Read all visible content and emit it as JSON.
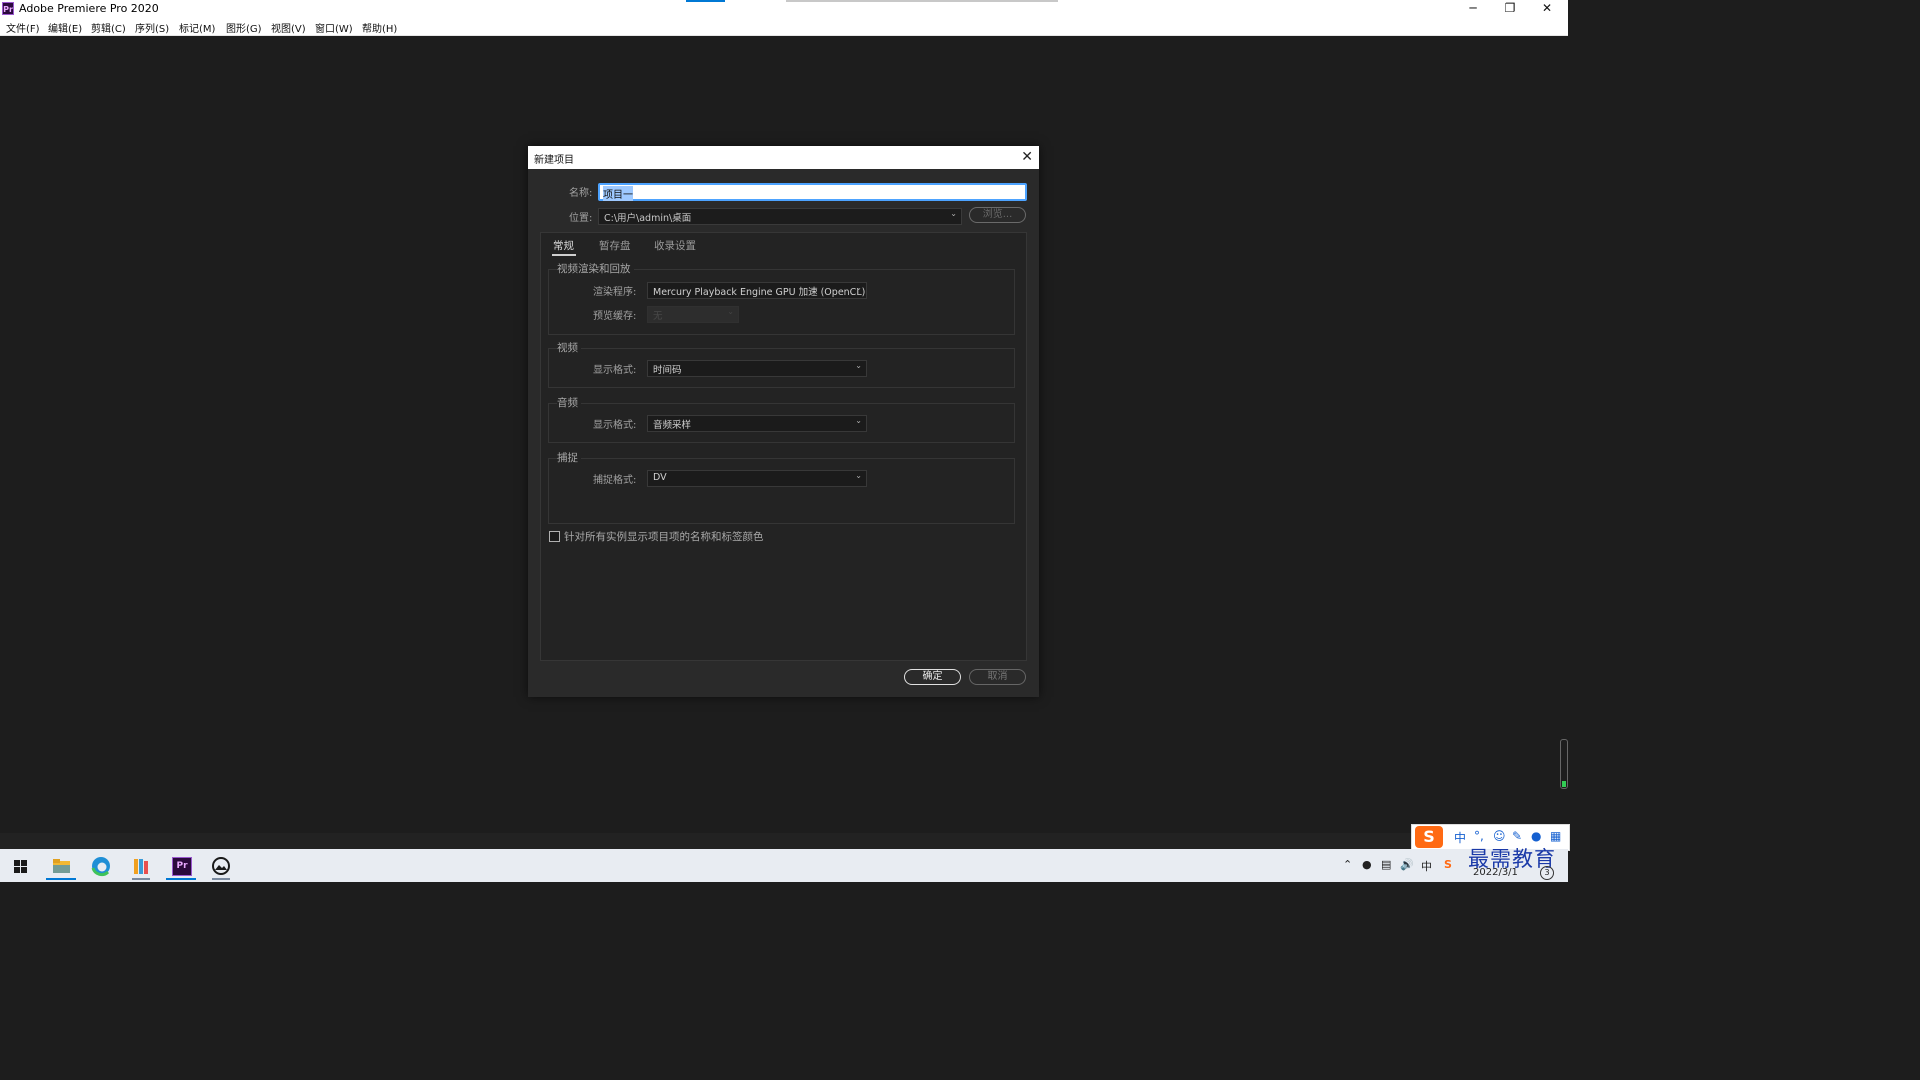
{
  "window": {
    "title": "Adobe Premiere Pro 2020",
    "app_icon": "Pr"
  },
  "window_controls": {
    "minimize": "─",
    "restore": "❐",
    "close": "✕"
  },
  "menubar": [
    "文件(F)",
    "编辑(E)",
    "剪辑(C)",
    "序列(S)",
    "标记(M)",
    "图形(G)",
    "视图(V)",
    "窗口(W)",
    "帮助(H)"
  ],
  "dialog": {
    "title": "新建项目",
    "close_icon": "✕",
    "name_label": "名称:",
    "name_value": "项目一",
    "location_label": "位置:",
    "location_value": "C:\\用户\\admin\\桌面",
    "browse_label": "浏览...",
    "tabs": [
      "常规",
      "暂存盘",
      "收录设置"
    ],
    "active_tab": "常规",
    "groups": {
      "render": {
        "title": "视频渲染和回放",
        "renderer_label": "渲染程序:",
        "renderer_value": "Mercury Playback Engine GPU 加速 (OpenCL)",
        "preview_cache_label": "预览缓存:",
        "preview_cache_value": "无"
      },
      "video": {
        "title": "视频",
        "format_label": "显示格式:",
        "format_value": "时间码"
      },
      "audio": {
        "title": "音频",
        "format_label": "显示格式:",
        "format_value": "音频采样"
      },
      "capture": {
        "title": "捕捉",
        "format_label": "捕捉格式:",
        "format_value": "DV"
      }
    },
    "checkbox_label": "针对所有实例显示项目项的名称和标签颜色",
    "checkbox_checked": false,
    "ok_label": "确定",
    "cancel_label": "取消"
  },
  "taskbar": {
    "apps": [
      "windows-start-icon",
      "file-explorer-icon",
      "edge-icon",
      "books-icon",
      "premiere-icon",
      "photos-icon"
    ],
    "premiere_label": "Pr",
    "ime": {
      "logo": "S",
      "lang": "中"
    },
    "tray": {
      "lang": "中"
    },
    "date": "2022/3/1",
    "notification_count": "3"
  },
  "watermark": "最需教育",
  "colors": {
    "accent": "#0078d4",
    "focus": "#4da3ff",
    "panel_bg": "#232323",
    "app_bg": "#1d1d1d"
  }
}
